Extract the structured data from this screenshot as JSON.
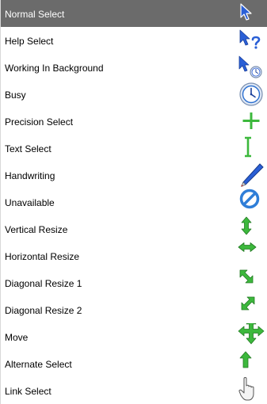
{
  "cursor_list": {
    "items": [
      {
        "label": "Normal Select",
        "icon": "arrow-pointer-icon"
      },
      {
        "label": "Help Select",
        "icon": "arrow-help-icon"
      },
      {
        "label": "Working In Background",
        "icon": "arrow-busy-icon"
      },
      {
        "label": "Busy",
        "icon": "busy-clock-icon"
      },
      {
        "label": "Precision Select",
        "icon": "crosshair-icon"
      },
      {
        "label": "Text Select",
        "icon": "text-beam-icon"
      },
      {
        "label": "Handwriting",
        "icon": "pen-icon"
      },
      {
        "label": "Unavailable",
        "icon": "unavailable-icon"
      },
      {
        "label": "Vertical Resize",
        "icon": "vertical-resize-icon"
      },
      {
        "label": "Horizontal Resize",
        "icon": "horizontal-resize-icon"
      },
      {
        "label": "Diagonal Resize 1",
        "icon": "diagonal-resize-1-icon"
      },
      {
        "label": "Diagonal Resize 2",
        "icon": "diagonal-resize-2-icon"
      },
      {
        "label": "Move",
        "icon": "move-icon"
      },
      {
        "label": "Alternate Select",
        "icon": "up-arrow-icon"
      },
      {
        "label": "Link Select",
        "icon": "hand-pointer-icon"
      }
    ],
    "selected_index": 0
  },
  "colors": {
    "selected_row": "#6b6b6b",
    "selected_text": "#ffffff",
    "cursor_blue": "#2a5fd6",
    "cursor_green": "#3cb83c",
    "unavailable_blue": "#2f7ed8"
  }
}
